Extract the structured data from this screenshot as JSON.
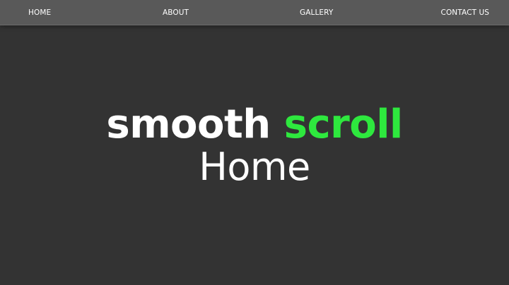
{
  "nav": {
    "items": [
      {
        "label": "HOME"
      },
      {
        "label": "ABOUT"
      },
      {
        "label": "GALLERY"
      },
      {
        "label": "CONTACT US"
      }
    ]
  },
  "hero": {
    "title_part1": "smooth",
    "title_part2": "scroll",
    "subtitle": "Home"
  },
  "colors": {
    "background": "#333333",
    "navbar": "#595959",
    "accent_green": "#2ee83e",
    "text": "#ffffff"
  }
}
